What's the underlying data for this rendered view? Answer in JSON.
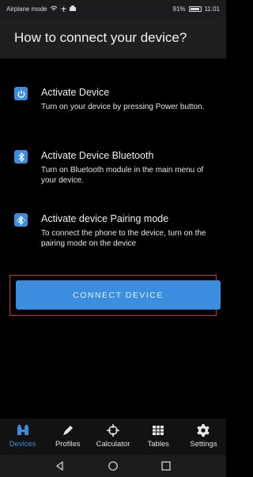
{
  "status_bar": {
    "left_text": "Airplane mode",
    "battery": "91%",
    "time": "11:01"
  },
  "header": {
    "title": "How to connect your device?"
  },
  "steps": [
    {
      "title": "Activate Device",
      "description": "Turn on your device by pressing Power button.",
      "icon": "power-icon"
    },
    {
      "title": "Activate Device Bluetooth",
      "description": "Turn on Bluetooth module in the main menu of your device.",
      "icon": "bluetooth-icon"
    },
    {
      "title": "Activate device Pairing mode",
      "description": "To connect the phone to the device, turn on the pairing mode on the device",
      "icon": "bluetooth-pairing-icon"
    }
  ],
  "connect_button": {
    "label": "CONNECT DEVICE"
  },
  "tabs": [
    {
      "label": "Devices",
      "icon": "devices-icon",
      "active": true
    },
    {
      "label": "Profiles",
      "icon": "pen-icon"
    },
    {
      "label": "Calculator",
      "icon": "crosshair-icon"
    },
    {
      "label": "Tables",
      "icon": "grid-icon"
    },
    {
      "label": "Settings",
      "icon": "gear-icon"
    }
  ],
  "colors": {
    "accent": "#3b8de0",
    "highlight_border": "#d62828"
  }
}
